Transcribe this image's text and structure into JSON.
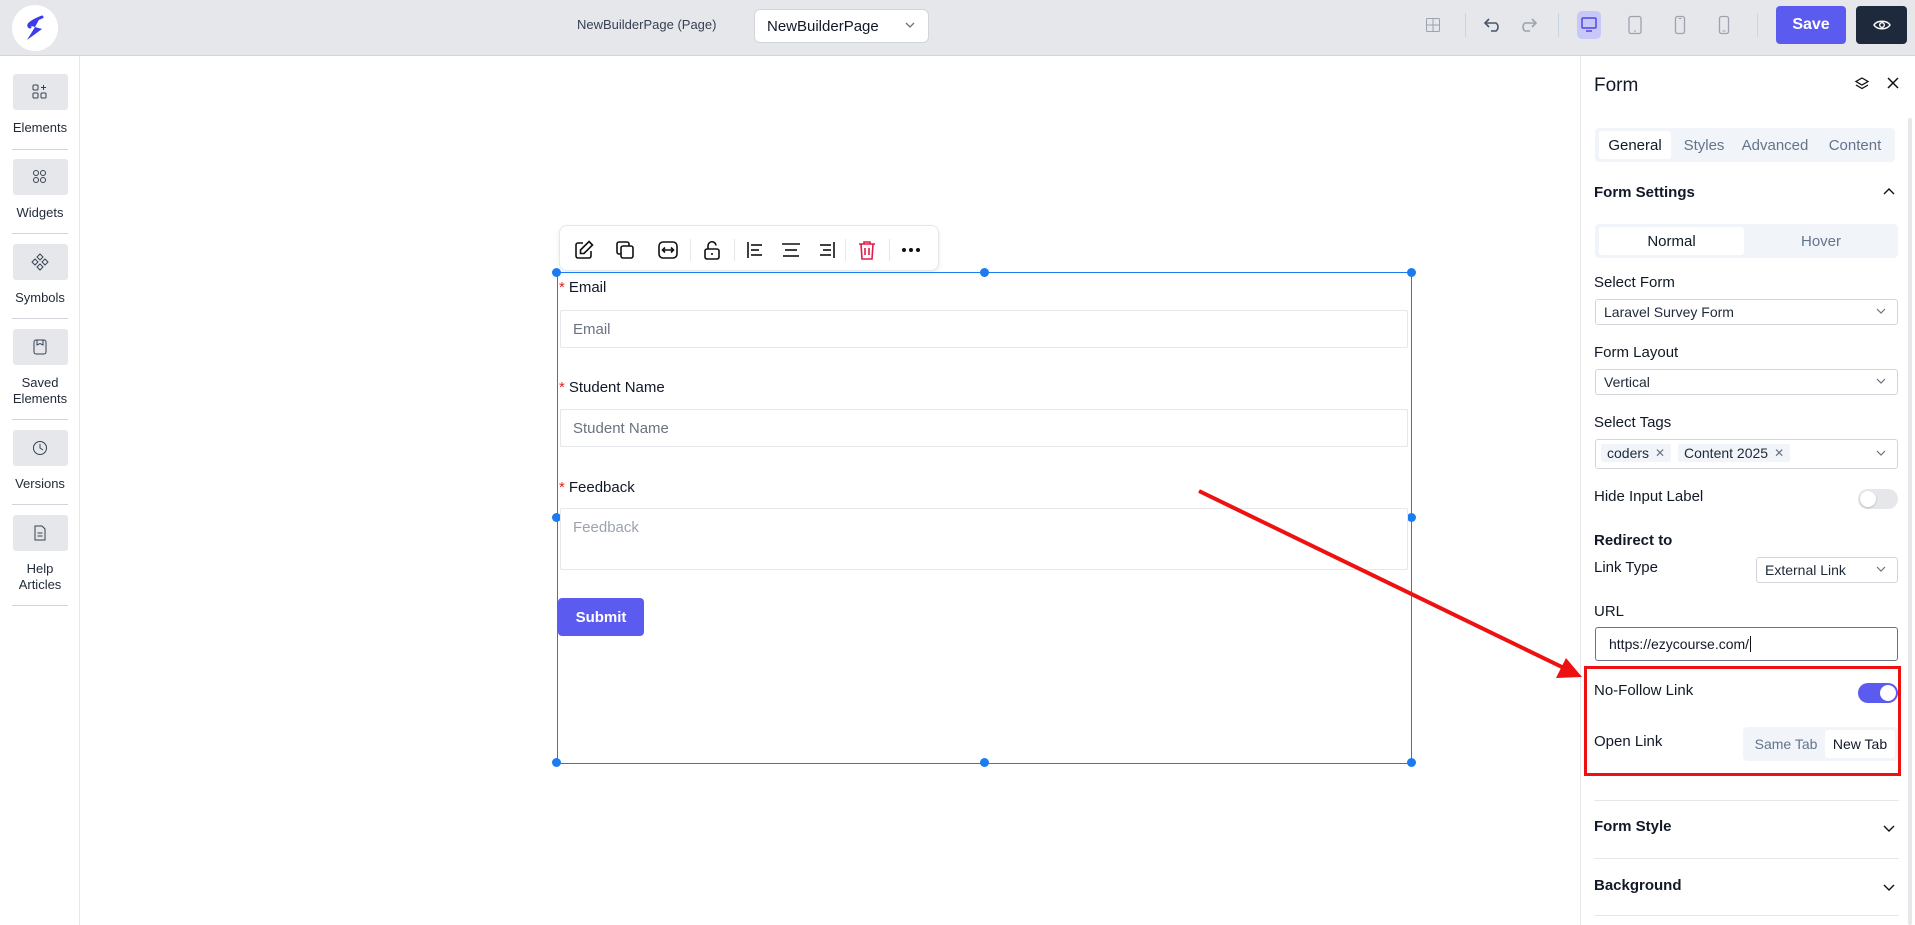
{
  "topbar": {
    "page_label": "NewBuilderPage (Page)",
    "page_select_value": "NewBuilderPage",
    "save_label": "Save",
    "icons": [
      "grid-icon",
      "undo-icon",
      "redo-icon",
      "desktop-icon",
      "tablet-icon",
      "mobile-icon",
      "mobile-landscape-icon",
      "eye-icon"
    ]
  },
  "sidebar": {
    "items": [
      {
        "label": "Elements",
        "icon": "elements-icon"
      },
      {
        "label": "Widgets",
        "icon": "widgets-icon"
      },
      {
        "label": "Symbols",
        "icon": "symbols-icon"
      },
      {
        "label": "Saved Elements",
        "icon": "saved-icon"
      },
      {
        "label": "Versions",
        "icon": "versions-icon"
      },
      {
        "label": "Help Articles",
        "icon": "help-icon"
      }
    ]
  },
  "canvas": {
    "fields": [
      {
        "label": "Email",
        "placeholder": "Email"
      },
      {
        "label": "Student Name",
        "placeholder": "Student Name"
      },
      {
        "label": "Feedback",
        "placeholder": "Feedback"
      }
    ],
    "required_mark": "*",
    "submit_label": "Submit"
  },
  "panel": {
    "title": "Form",
    "tabs": [
      "General",
      "Styles",
      "Advanced",
      "Content"
    ],
    "form_settings_title": "Form Settings",
    "state_tabs": [
      "Normal",
      "Hover"
    ],
    "select_form_label": "Select Form",
    "select_form_value": "Laravel Survey Form",
    "form_layout_label": "Form Layout",
    "form_layout_value": "Vertical",
    "select_tags_label": "Select Tags",
    "tags": [
      "coders",
      "Content 2025"
    ],
    "hide_input_label": "Hide Input Label",
    "redirect_title": "Redirect to",
    "link_type_label": "Link Type",
    "link_type_value": "External Link",
    "url_label": "URL",
    "url_value": "https://ezycourse.com/",
    "nofollow_label": "No-Follow Link",
    "open_link_label": "Open Link",
    "open_link_options": [
      "Same Tab",
      "New Tab"
    ],
    "form_style_title": "Form Style",
    "background_title": "Background"
  },
  "colors": {
    "accent": "#5b5bf0",
    "selection": "#1a7cf0",
    "annotation": "#ee1111"
  }
}
